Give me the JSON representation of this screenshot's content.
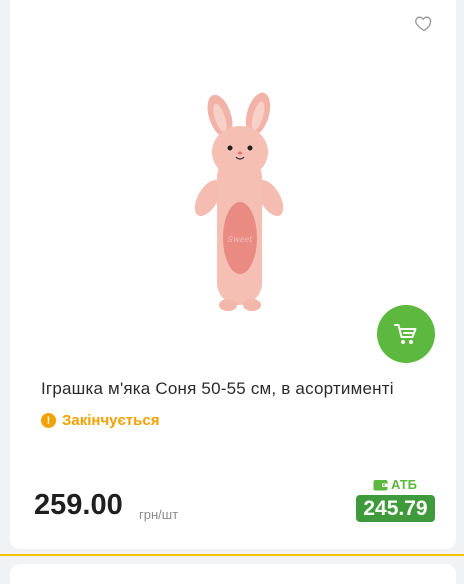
{
  "product": {
    "title": "Іграшка м'яка Соня 50-55 см, в асортименті",
    "status": "Закінчується",
    "price": "259.00",
    "unit": "грн/шт",
    "atb_label": "АТБ",
    "atb_price": "245.79",
    "image_alt": "pink-bunny-plush"
  },
  "icons": {
    "favorite": "heart-outline-icon",
    "cart": "shopping-cart-icon",
    "status": "exclamation-icon",
    "wallet": "wallet-icon"
  },
  "colors": {
    "accent_green": "#5cb83e",
    "atb_green": "#3e9a3a",
    "warning": "#f2a100",
    "divider": "#f5c400"
  }
}
